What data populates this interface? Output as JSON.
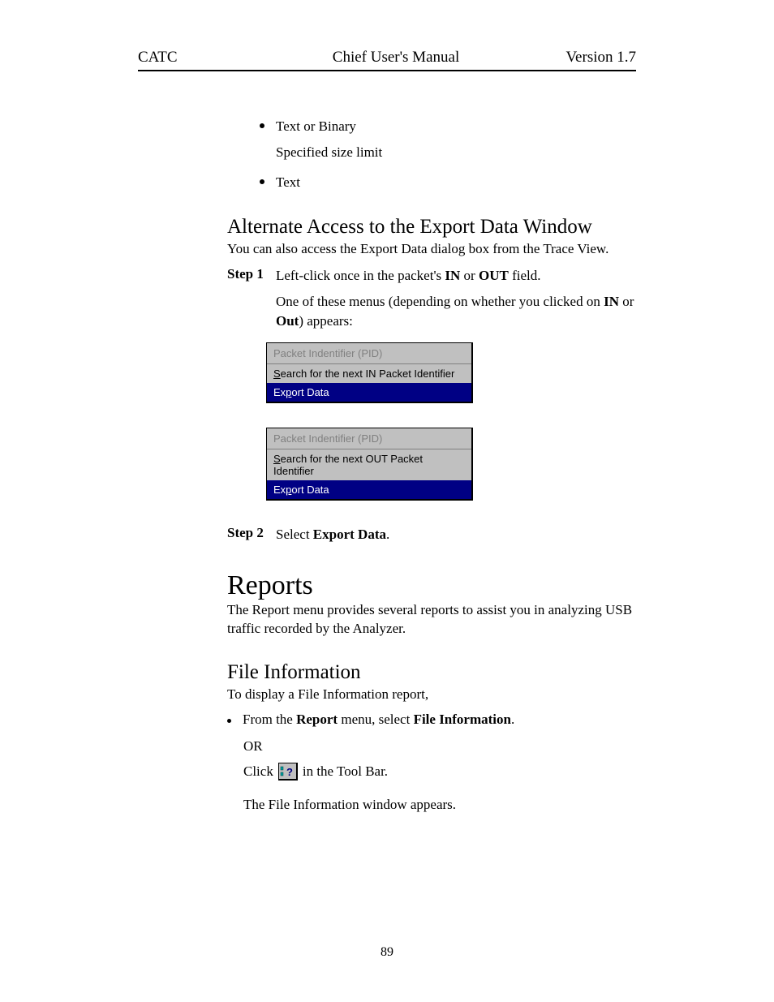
{
  "header": {
    "left": "CATC",
    "center": "Chief User's Manual",
    "right": "Version 1.7"
  },
  "top_bullets": {
    "b1": "Text or Binary",
    "b1_sub": "Specified size limit",
    "b2": "Text"
  },
  "alt_access": {
    "heading": "Alternate Access to the Export Data Window",
    "intro": "You can also access the Export Data dialog box from the Trace View.",
    "step1_label": "Step 1",
    "step1_pre": "Left-click once in the packet's ",
    "step1_in": "IN",
    "step1_or": " or ",
    "step1_out": "OUT",
    "step1_post": " field.",
    "step1_sub_pre": "One of these menus (depending on whether you clicked on ",
    "step1_sub_in": "IN",
    "step1_sub_or": " or ",
    "step1_sub_out": "Out",
    "step1_sub_post": ") appears:",
    "menu1": {
      "header": "Packet Indentifier (PID)",
      "item_s": "S",
      "item_rest": "earch for the next IN Packet Identifier",
      "highlight_pre": "Ex",
      "highlight_u": "p",
      "highlight_post": "ort Data"
    },
    "menu2": {
      "header": "Packet Indentifier (PID)",
      "item_s": "S",
      "item_rest": "earch for the next OUT Packet Identifier",
      "highlight_pre": "Ex",
      "highlight_u": "p",
      "highlight_post": "ort Data"
    },
    "step2_label": "Step 2",
    "step2_pre": "Select ",
    "step2_bold": "Export Data",
    "step2_post": "."
  },
  "reports": {
    "heading": "Reports",
    "intro": "The Report menu provides several reports to assist you in analyzing USB traffic recorded by the Analyzer."
  },
  "file_info": {
    "heading": "File Information",
    "intro": "To display a File Information report,",
    "bullet_pre": "From the ",
    "bullet_b1": "Report",
    "bullet_mid": " menu, select ",
    "bullet_b2": "File Information",
    "bullet_post": ".",
    "or": "OR",
    "click_pre": "Click ",
    "click_post": " in the Tool Bar.",
    "result": "The File Information window appears."
  },
  "page_number": "89"
}
